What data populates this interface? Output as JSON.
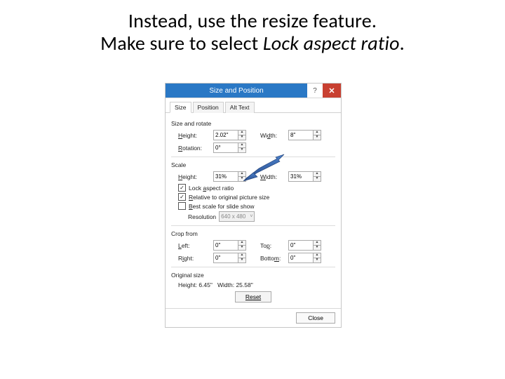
{
  "slide": {
    "line1": "Instead, use the resize feature.",
    "line2a": "Make sure to select ",
    "line2b": "Lock aspect ratio",
    "line2c": "."
  },
  "dialog": {
    "title": "Size and Position",
    "help": "?",
    "close": "✕",
    "tabs": {
      "size": "Size",
      "position": "Position",
      "altText": "Alt Text"
    },
    "groups": {
      "sizeRotate": "Size and rotate",
      "scale": "Scale",
      "cropFrom": "Crop from",
      "originalSize": "Original size"
    },
    "labels": {
      "height": "Height:",
      "width": "Width:",
      "rotation": "Rotation:",
      "scaleHeight": "Height:",
      "scaleWidth": "Width:",
      "lockAspect": "Lock aspect ratio",
      "relative": "Relative to original picture size",
      "bestScale": "Best scale for slide show",
      "resolution": "Resolution",
      "left": "Left:",
      "top": "Top:",
      "right": "Right:",
      "bottom": "Bottom:",
      "origHeight": "Height:",
      "origWidth": "Width:",
      "reset": "Reset",
      "closeBtn": "Close"
    },
    "values": {
      "height": "2.02\"",
      "width": "8\"",
      "rotation": "0°",
      "scaleHeight": "31%",
      "scaleWidth": "31%",
      "resolution": "640 x 480",
      "cropLeft": "0\"",
      "cropTop": "0\"",
      "cropRight": "0\"",
      "cropBottom": "0\"",
      "origHeight": "6.45\"",
      "origWidth": "25.58\""
    },
    "checks": {
      "lockAspect": true,
      "relative": true,
      "bestScale": false
    }
  }
}
